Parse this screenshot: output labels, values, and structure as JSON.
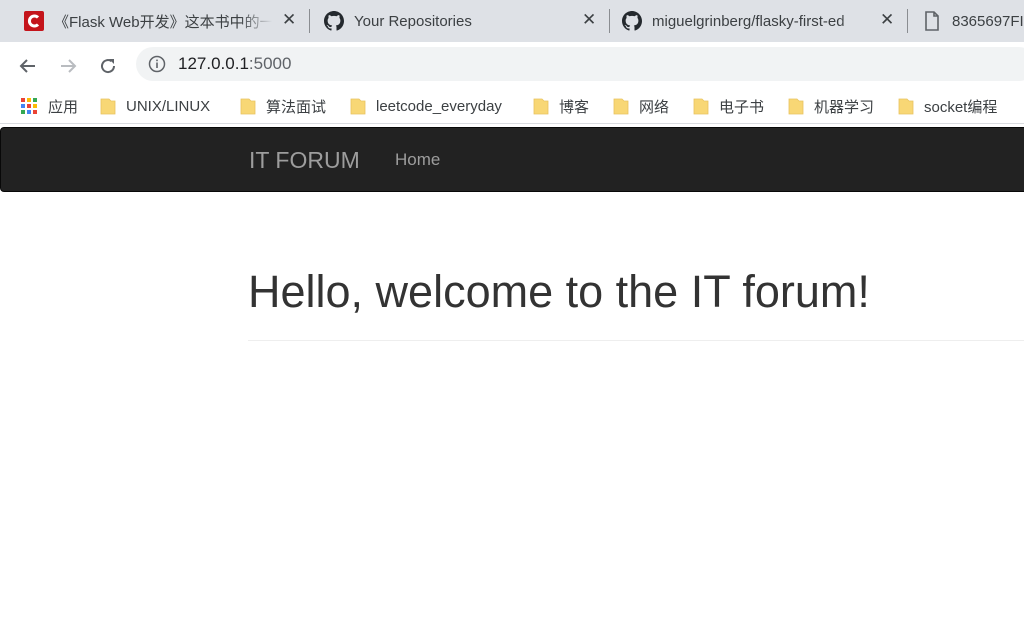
{
  "tabs": [
    {
      "title": "《Flask Web开发》这本书中的一",
      "icon": "c-icon",
      "icon_color": "#c4141b"
    },
    {
      "title": "Your Repositories",
      "icon": "github-icon"
    },
    {
      "title": "miguelgrinberg/flasky-first-ed",
      "icon": "github-icon"
    },
    {
      "title": "8365697FI",
      "icon": "file-icon"
    }
  ],
  "omnibox": {
    "host": "127.0.0.1",
    "port": ":5000"
  },
  "bookmarks": {
    "apps": "应用",
    "items": [
      "UNIX/LINUX",
      "算法面试",
      "leetcode_everyday",
      "博客",
      "网络",
      "电子书",
      "机器学习",
      "socket编程"
    ]
  },
  "colors": {
    "navbar_bg": "#222222",
    "nav_text": "#9d9d9d",
    "folder": "#f8d775",
    "heading": "#333333"
  },
  "page": {
    "brand": "IT FORUM",
    "nav_home": "Home",
    "heading": "Hello, welcome to the IT forum!"
  }
}
